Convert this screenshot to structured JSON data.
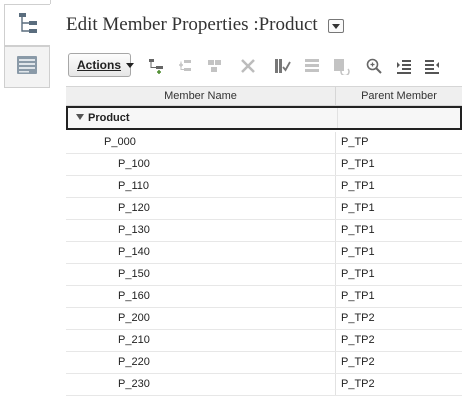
{
  "page": {
    "title": "Edit Member Properties :Product"
  },
  "toolbar": {
    "actions_label": "Actions",
    "icons": [
      "add-child-icon",
      "add-sibling-icon",
      "duplicate-icon",
      "delete-icon",
      "validate-icon",
      "move-icon",
      "refresh-icon",
      "zoom-icon",
      "expand-icon",
      "collapse-icon"
    ]
  },
  "grid": {
    "columns": [
      "Member Name",
      "Parent Member"
    ],
    "root": {
      "name": "Product",
      "parent": ""
    },
    "rows": [
      {
        "name": "P_000",
        "parent": "P_TP"
      },
      {
        "name": "P_100",
        "parent": "P_TP1"
      },
      {
        "name": "P_110",
        "parent": "P_TP1"
      },
      {
        "name": "P_120",
        "parent": "P_TP1"
      },
      {
        "name": "P_130",
        "parent": "P_TP1"
      },
      {
        "name": "P_140",
        "parent": "P_TP1"
      },
      {
        "name": "P_150",
        "parent": "P_TP1"
      },
      {
        "name": "P_160",
        "parent": "P_TP1"
      },
      {
        "name": "P_200",
        "parent": "P_TP2"
      },
      {
        "name": "P_210",
        "parent": "P_TP2"
      },
      {
        "name": "P_220",
        "parent": "P_TP2"
      },
      {
        "name": "P_230",
        "parent": "P_TP2"
      }
    ]
  },
  "colors": {
    "icon_active": "#555555",
    "icon_disabled": "#bcbcbc",
    "rail_icon": "#5a6d7e"
  }
}
